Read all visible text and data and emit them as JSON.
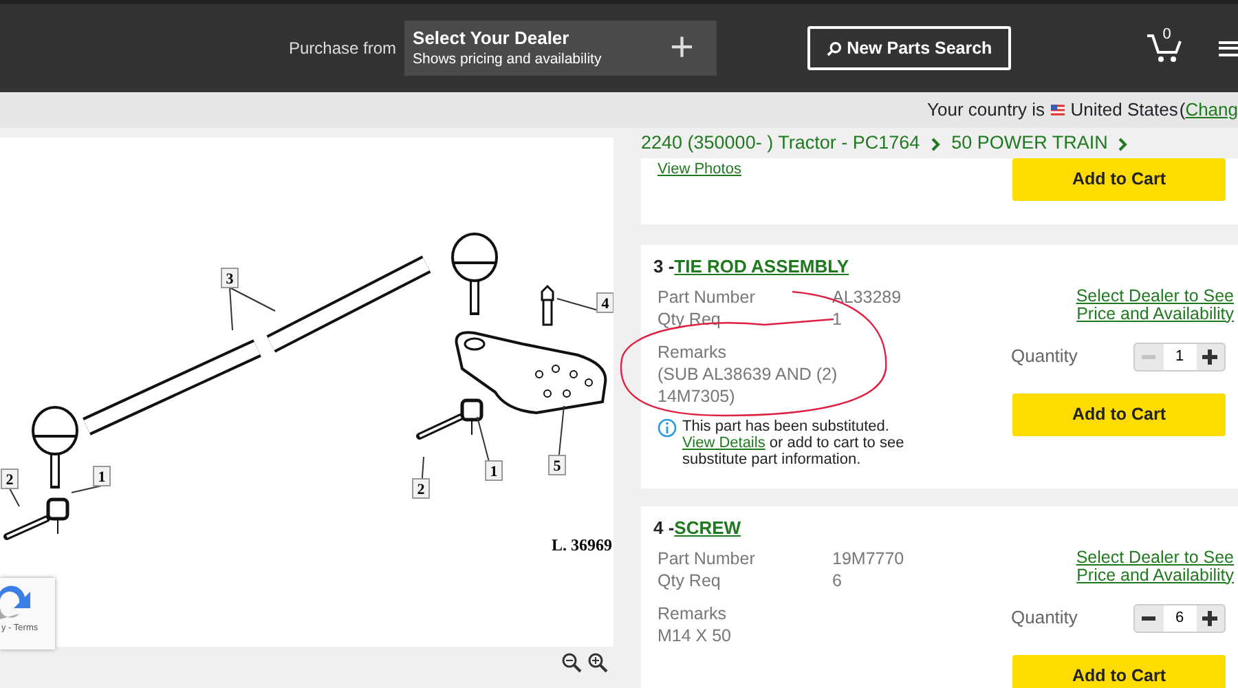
{
  "header": {
    "purchase_label": "Purchase from",
    "dealer": {
      "title": "Select Your Dealer",
      "subtitle": "Shows pricing and availability",
      "add_icon": "+"
    },
    "search_button": "New Parts Search",
    "cart_count": "0"
  },
  "country_bar": {
    "prefix": "Your country is",
    "country": "United States",
    "open_paren": "(",
    "change_link": "Chang"
  },
  "breadcrumb": [
    "2240 (350000- ) Tractor - PC1764",
    "50 POWER TRAIN"
  ],
  "diagram": {
    "callouts": [
      "3",
      "4",
      "2",
      "1",
      "1",
      "2",
      "5"
    ],
    "figure_label": "L. 36969"
  },
  "recaptcha": {
    "text": "y - Terms"
  },
  "parts": [
    {
      "kind": "partial",
      "view_photos": "View Photos",
      "add_button": "Add to Cart"
    },
    {
      "kind": "full",
      "index": "3 -",
      "name": "TIE ROD ASSEMBLY",
      "fields": [
        {
          "label": "Part Number",
          "value": "AL33289"
        },
        {
          "label": "Qty Req",
          "value": "1"
        }
      ],
      "remarks_label": "Remarks",
      "remarks": "(SUB AL38639 AND (2) 14M7305)",
      "notice": {
        "before": "This part has been substituted. ",
        "link": "View Details",
        "after": " or add to cart to see substitute part information."
      },
      "dealer_link": "Select Dealer to See Price and Availability",
      "quantity_label": "Quantity",
      "quantity": "1",
      "minus_disabled": true,
      "add_button": "Add to Cart",
      "annotated": true
    },
    {
      "kind": "full",
      "index": "4 -",
      "name": "SCREW",
      "fields": [
        {
          "label": "Part Number",
          "value": "19M7770"
        },
        {
          "label": "Qty Req",
          "value": "6"
        }
      ],
      "remarks_label": "Remarks",
      "remarks": "M14 X 50",
      "dealer_link": "Select Dealer to See Price and Availability",
      "quantity_label": "Quantity",
      "quantity": "6",
      "minus_disabled": false,
      "add_button": "Add to Cart",
      "annotated": false
    }
  ]
}
